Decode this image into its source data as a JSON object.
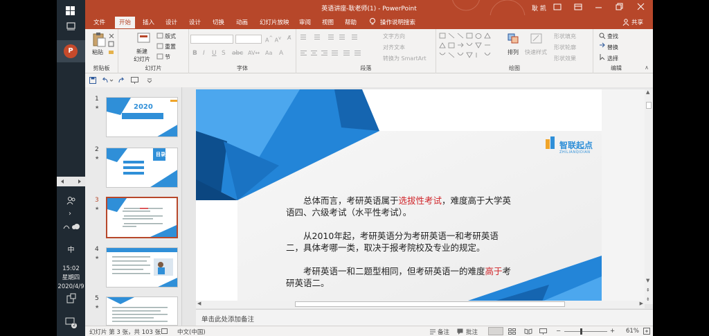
{
  "window": {
    "title": "英语讲座-耿老师(1)  -  PowerPoint",
    "user": "耿 凯"
  },
  "taskbar": {
    "ime": "中",
    "time": "15:02",
    "weekday": "星期四",
    "date": "2020/4/9",
    "notif_count": "2"
  },
  "tabs": [
    "文件",
    "开始",
    "插入",
    "设计",
    "设计",
    "切换",
    "动画",
    "幻灯片放映",
    "审阅",
    "视图",
    "帮助",
    "操作说明搜索"
  ],
  "share_label": "共享",
  "ribbon": {
    "clipboard": {
      "label": "剪贴板",
      "paste": "粘贴"
    },
    "slides": {
      "label": "幻灯片",
      "new_slide_1": "新建",
      "new_slide_2": "幻灯片",
      "layout": "版式",
      "reset": "重置",
      "section": "节"
    },
    "font": {
      "label": "字体"
    },
    "paragraph": {
      "label": "段落",
      "text_direction": "文字方向",
      "align_text": "对齐文本",
      "smartart": "转换为 SmartArt"
    },
    "drawing": {
      "label": "绘图",
      "arrange": "排列",
      "quick_styles": "快速样式",
      "shape_fill": "形状填充",
      "shape_outline": "形状轮廓",
      "shape_effects": "形状效果"
    },
    "editing": {
      "label": "编辑",
      "find": "查找",
      "replace": "替换",
      "select": "选择"
    }
  },
  "thumbnails": [
    {
      "num": "1",
      "caption": "2020"
    },
    {
      "num": "2",
      "caption": "目录"
    },
    {
      "num": "3"
    },
    {
      "num": "4"
    },
    {
      "num": "5"
    }
  ],
  "slide": {
    "logo": "智联起点",
    "logo_sub": "ZHILIANQIDIAN",
    "p1_a": "总体而言，考研英语属于",
    "p1_b": "选拔性考试",
    "p1_c": "，难度高于大学英语四、六级考试（水平性考试）。",
    "p2": "从2010年起，考研英语分为考研英语一和考研英语二，具体考哪一类，取决于报考院校及专业的规定。",
    "p3_a": "考研英语一和二题型相同，但考研英语一的难度",
    "p3_b": "高于",
    "p3_c": "考研英语二。"
  },
  "notes_placeholder": "单击此处添加备注",
  "status": {
    "slide_info": "幻灯片 第 3 张，共 103 张",
    "language": "中文(中国)",
    "notes": "备注",
    "comments": "批注",
    "zoom": "61%"
  },
  "colors": {
    "accent": "#b7472a",
    "slide_blue": "#1f7fd0",
    "highlight_red": "#d0252a"
  }
}
